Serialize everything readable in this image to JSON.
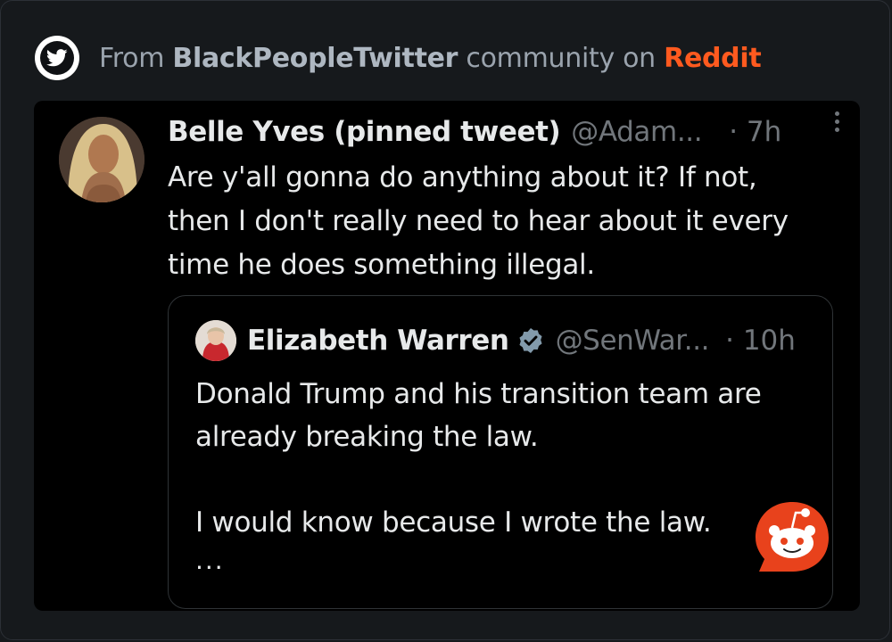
{
  "header": {
    "prefix": "From",
    "community": "BlackPeopleTwitter",
    "middle": "community on",
    "platform": "Reddit"
  },
  "tweet": {
    "author_name": "Belle Yves (pinned tweet)",
    "handle": "@Adam...",
    "time": "· 7h",
    "lines": [
      "Are y'all gonna do anything about it? If not,",
      "then I don't really need to hear about it every",
      "time he does something illegal."
    ]
  },
  "quote": {
    "author_name": "Elizabeth Warren",
    "handle": "@SenWar...",
    "time": "· 10h",
    "paragraph1": [
      "Donald Trump and his transition team are",
      "already breaking the law."
    ],
    "paragraph2": "I would know because I wrote the law.",
    "ellipsis": "..."
  },
  "icons": {
    "header_icon": "twitter-bird-icon",
    "more_icon": "more-vertical-icon",
    "verified_icon": "verified-badge-icon",
    "reddit_icon": "reddit-snoo-icon"
  },
  "colors": {
    "reddit_orange": "#ff5a1f",
    "background": "#16191c",
    "tweet_bg": "#000000",
    "text": "#e7e9ea",
    "muted": "#71767b",
    "verified": "#829aab"
  }
}
